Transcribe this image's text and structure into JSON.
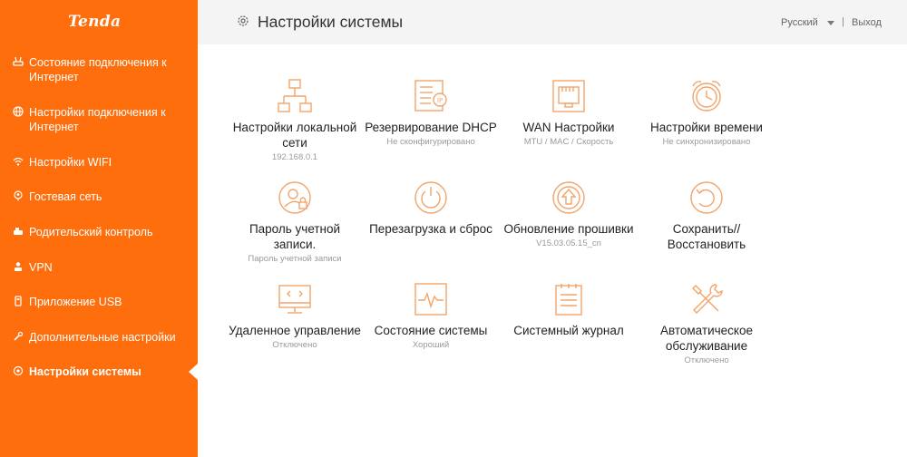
{
  "brand": {
    "logo_text": "Tenda",
    "accent": "#ff6e0d"
  },
  "sidebar": {
    "items": [
      {
        "label": "Состояние подключения к Интернет",
        "icon": "connection-status-icon"
      },
      {
        "label": "Настройки подключения к Интернет",
        "icon": "globe-icon"
      },
      {
        "label": "Настройки WIFI",
        "icon": "wifi-icon"
      },
      {
        "label": "Гостевая сеть",
        "icon": "guest-icon"
      },
      {
        "label": "Родительский контроль",
        "icon": "parental-icon"
      },
      {
        "label": "VPN",
        "icon": "vpn-icon"
      },
      {
        "label": "Приложение USB",
        "icon": "usb-icon"
      },
      {
        "label": "Дополнительные настройки",
        "icon": "wrench-icon"
      },
      {
        "label": "Настройки системы",
        "icon": "gear-icon",
        "active": true
      }
    ]
  },
  "header": {
    "title": "Настройки системы",
    "language": "Русский",
    "separator": "|",
    "logout": "Выход"
  },
  "tiles": [
    {
      "label": "Настройки локальной сети",
      "sub": "192.168.0.1",
      "icon": "lan-topology-icon"
    },
    {
      "label": "Резервирование DHCP",
      "sub": "Не сконфигурировано",
      "icon": "dhcp-reservation-icon"
    },
    {
      "label": "WAN Настройки",
      "sub": "MTU / MAC / Скорость",
      "icon": "ethernet-port-icon"
    },
    {
      "label": "Настройки времени",
      "sub": "Не синхронизировано",
      "icon": "alarm-clock-icon"
    },
    {
      "label": "Пароль учетной записи.",
      "sub": "Пароль учетной записи",
      "icon": "user-lock-icon"
    },
    {
      "label": "Перезагрузка и сброс",
      "sub": "",
      "icon": "power-icon"
    },
    {
      "label": "Обновление прошивки",
      "sub": "V15.03.05.15_cn",
      "icon": "upgrade-arrow-icon"
    },
    {
      "label": "Сохранить//Восстановить",
      "sub": "",
      "icon": "restore-icon"
    },
    {
      "label": "Удаленное управление",
      "sub": "Отключено",
      "icon": "remote-monitor-icon"
    },
    {
      "label": "Состояние системы",
      "sub": "Хороший",
      "icon": "pulse-monitor-icon"
    },
    {
      "label": "Системный журнал",
      "sub": "",
      "icon": "log-document-icon"
    },
    {
      "label": "Автоматическое обслуживание",
      "sub": "Отключено",
      "icon": "tools-icon"
    }
  ]
}
